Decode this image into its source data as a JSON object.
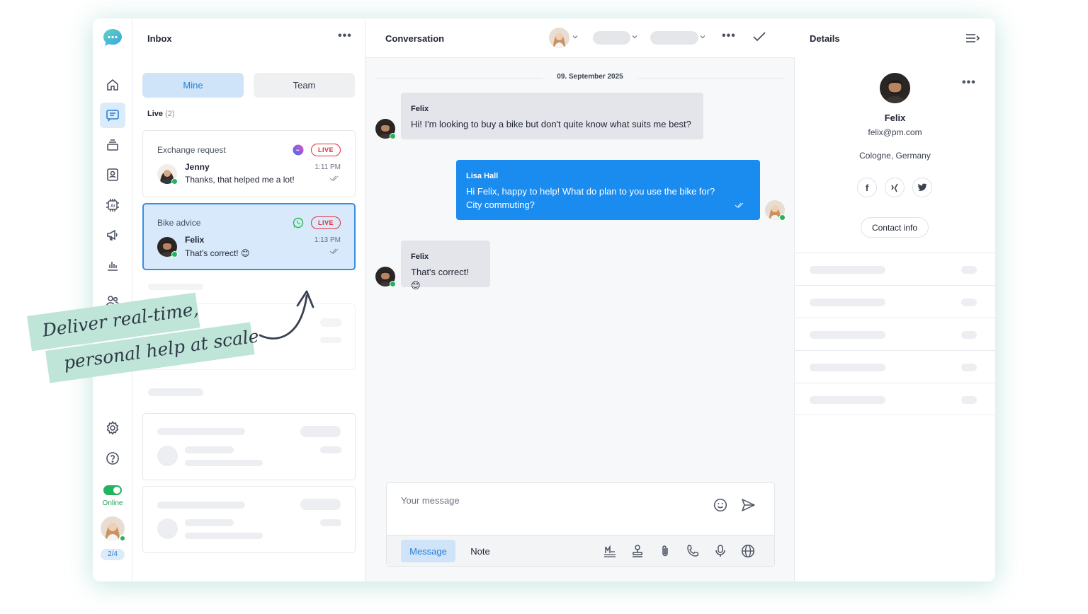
{
  "inbox": {
    "title": "Inbox",
    "tabs": [
      "Mine",
      "Team"
    ],
    "live_label": "Live",
    "live_count": "(2)",
    "cards": [
      {
        "subject": "Exchange request",
        "badge": "LIVE",
        "channel": "messenger-icon",
        "name": "Jenny",
        "preview": "Thanks, that helped me a lot!",
        "time": "1:11 PM"
      },
      {
        "subject": "Bike advice",
        "badge": "LIVE",
        "channel": "whatsapp-icon",
        "name": "Felix",
        "preview": "That's correct! 😊",
        "time": "1:13 PM"
      }
    ]
  },
  "conversation": {
    "title": "Conversation",
    "date": "09. September 2025",
    "messages": [
      {
        "from": "Felix",
        "text": "Hi! I'm looking to buy a bike but don't quite know what suits me best?",
        "direction": "in"
      },
      {
        "from": "Lisa Hall",
        "text": "Hi Felix, happy to help! What do plan to you use the bike for? City commuting?",
        "direction": "out"
      },
      {
        "from": "Felix",
        "text": "That's correct! 😊",
        "direction": "in"
      }
    ],
    "composer": {
      "placeholder": "Your message",
      "tab_message": "Message",
      "tab_note": "Note"
    }
  },
  "details": {
    "title": "Details",
    "name": "Felix",
    "email": "felix@pm.com",
    "location": "Cologne, Germany",
    "contact_button": "Contact info"
  },
  "sidebar": {
    "status": "Online",
    "page_badge": "2/4"
  },
  "annotation": {
    "line1": "Deliver real-time,",
    "line2": "personal help at scale"
  },
  "colors": {
    "accent": "#1a8cf0",
    "live": "#e0303a",
    "online": "#22b35e",
    "highlight": "#bfe4d8"
  }
}
